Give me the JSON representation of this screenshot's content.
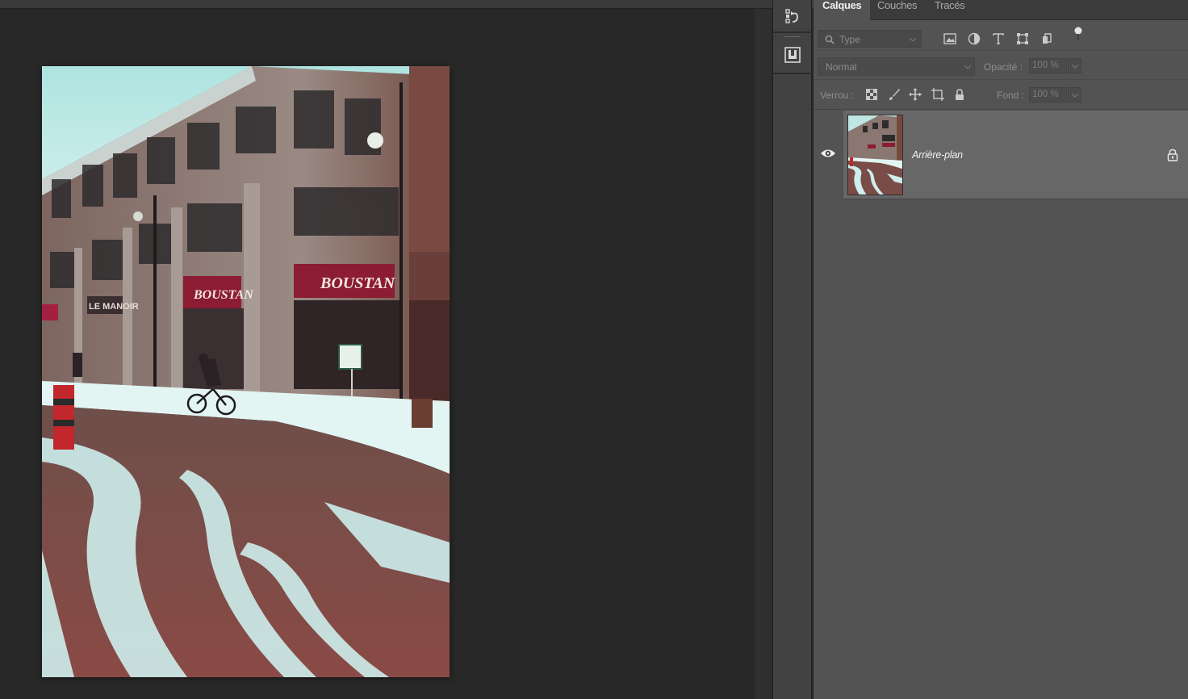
{
  "layers_panel": {
    "tabs": [
      {
        "label": "Calques",
        "active": true
      },
      {
        "label": "Couches",
        "active": false
      },
      {
        "label": "Tracés",
        "active": false
      }
    ],
    "filter": {
      "placeholder": "Type",
      "filter_icons": [
        "image-filter-icon",
        "adjustment-filter-icon",
        "text-filter-icon",
        "shape-filter-icon",
        "smart-object-filter-icon",
        "filter-toggle-icon"
      ]
    },
    "blend_mode": "Normal",
    "opacity_label": "Opacité :",
    "opacity_value": "100 %",
    "lock_label": "Verrou :",
    "lock_icons": [
      "lock-transparency-icon",
      "lock-image-pixels-icon",
      "lock-position-icon",
      "lock-artboard-icon",
      "lock-all-icon"
    ],
    "fill_label": "Fond :",
    "fill_value": "100 %",
    "layers": [
      {
        "name": "Arrière-plan",
        "visible": true,
        "locked": true
      }
    ]
  },
  "dock": {
    "buttons": [
      "history-icon",
      "properties-icon"
    ]
  },
  "document": {
    "photo_subject": "street-scene",
    "colors": {
      "canvas_bg": "#282828",
      "panel_bg": "#535353",
      "selected_layer_bg": "#676767"
    }
  }
}
